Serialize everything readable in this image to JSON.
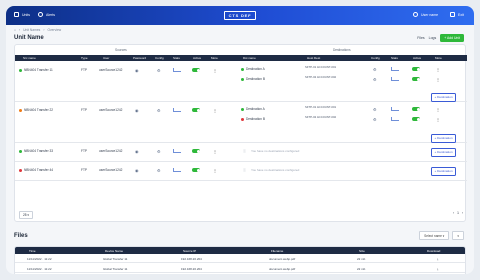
{
  "nav": {
    "units": "Units",
    "alerts": "Alerts",
    "logo": "CTS DEF",
    "user": "User name",
    "exit": "Exit"
  },
  "breadcrumb": [
    "Unit Names",
    "Overview"
  ],
  "page_title": "Unit Name",
  "header_actions": {
    "files": "Files",
    "logs": "Logs",
    "add": "+ Add Unit"
  },
  "group_headers": {
    "sources": "Sources",
    "destinations": "Destinations"
  },
  "source_columns": [
    "Src name",
    "Type",
    "User",
    "Password",
    "Config",
    "Stats",
    "Active",
    "More"
  ],
  "dest_columns": [
    "Dst name",
    "Host Dest",
    "Config",
    "Stats",
    "Active",
    "More"
  ],
  "rows": [
    {
      "status_color": "#2eb83a",
      "name": "NBN404 Transfer 11",
      "type": "FTP",
      "user": "userSource1242",
      "dests": [
        {
          "color": "#2eb83a",
          "name": "Destination A",
          "host": "SFTP-01 ACCOUNT-001"
        },
        {
          "color": "#2eb83a",
          "name": "Destination B",
          "host": "SFTP-02 ACCOUNT-002"
        }
      ],
      "add_label": "+ Destination"
    },
    {
      "status_color": "#f07b16",
      "name": "NBN404 Transfer 22",
      "type": "FTP",
      "user": "userSource1242",
      "dests": [
        {
          "color": "#2eb83a",
          "name": "Destination A",
          "host": "SFTP-01 ACCOUNT-001"
        },
        {
          "color": "#e0373b",
          "name": "Destination B",
          "host": "SFTP-02 ACCOUNT-002"
        }
      ],
      "add_label": "+ Destination"
    },
    {
      "status_color": "#2eb83a",
      "name": "NBN404 Transfer 33",
      "type": "FTP",
      "user": "userSource1242",
      "empty": "You have no destinations configured",
      "add_label": "+ Destination"
    },
    {
      "status_color": "#e0373b",
      "name": "NBN404 Transfer 44",
      "type": "FTP",
      "user": "userSource1242",
      "empty": "You have no destinations configured",
      "add_label": "+ Destination"
    }
  ],
  "pager": {
    "per_page": "25",
    "current": "1"
  },
  "files": {
    "title": "Files",
    "dropdown": "Select name",
    "columns": [
      "Time",
      "Device Name",
      "Source IP",
      "Filename",
      "Size",
      "Download"
    ],
    "rows": [
      {
        "time": "11/11/2022 · 11:22",
        "device": "Global Transfer 11",
        "ip": "192.168.20.204",
        "file": "document.webp.pdf",
        "size": "22 mb"
      },
      {
        "time": "11/11/2022 · 11:22",
        "device": "Global Transfer 11",
        "ip": "192.168.20.204",
        "file": "document.webp.pdf",
        "size": "22 mb"
      }
    ]
  }
}
